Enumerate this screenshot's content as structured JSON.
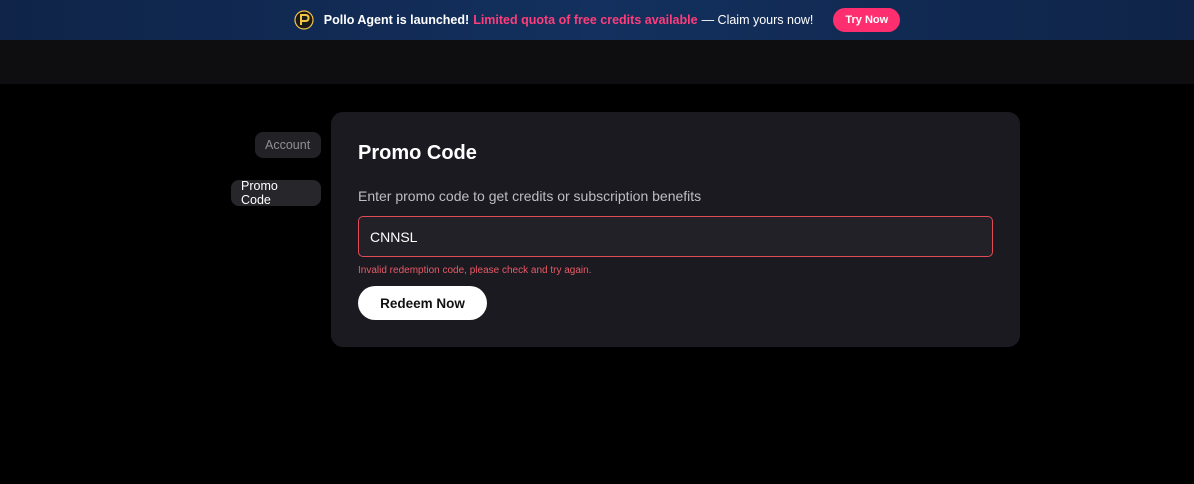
{
  "announcement": {
    "logo_icon": "pollo-logo-icon",
    "bold_text": "Pollo Agent is launched!",
    "highlight_text": "Limited quota of free credits available",
    "rest_text": "— Claim yours now!",
    "cta_label": "Try Now",
    "highlight_color": "#ff3d7a",
    "cta_color": "#ff2e6e"
  },
  "sidebar": {
    "items": [
      {
        "label": "Account",
        "active": false
      },
      {
        "label": "Promo Code",
        "active": true
      }
    ]
  },
  "promo": {
    "title": "Promo Code",
    "description": "Enter promo code to get credits or subscription benefits",
    "input_value": "CNNSL",
    "error_text": "Invalid redemption code, please check and try again.",
    "error_color": "#e04b55",
    "button_label": "Redeem Now"
  }
}
